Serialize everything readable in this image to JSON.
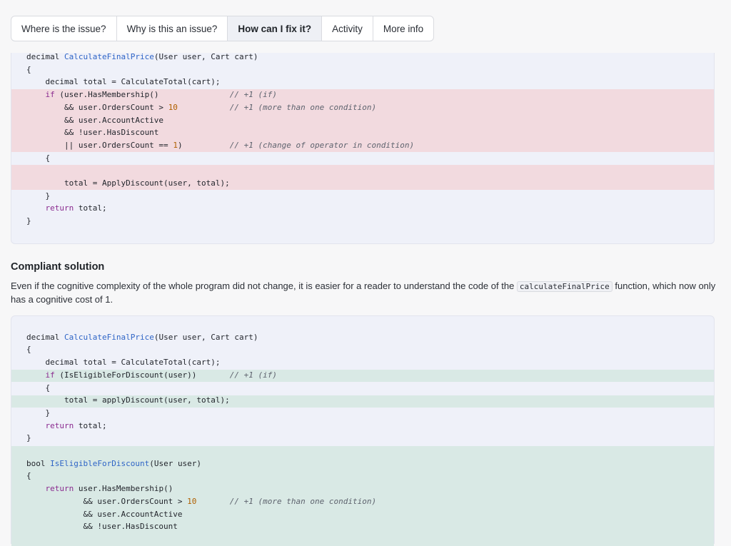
{
  "tabs": [
    {
      "label": "Where is the issue?"
    },
    {
      "label": "Why is this an issue?"
    },
    {
      "label": "How can I fix it?",
      "active": true
    },
    {
      "label": "Activity"
    },
    {
      "label": "More info"
    }
  ],
  "noncompliant_code": [
    "decimal CalculateFinalPrice(User user, Cart cart)",
    "{",
    "    decimal total = CalculateTotal(cart);",
    "    if (user.HasMembership()               // +1 (if)",
    "        && user.OrdersCount > 10           // +1 (more than one condition)",
    "        && user.AccountActive",
    "        && !user.HasDiscount",
    "        || user.OrdersCount == 1)          // +1 (change of operator in condition)",
    "    {",
    "",
    "        total = ApplyDiscount(user, total);",
    "    }",
    "    return total;",
    "}"
  ],
  "compliant": {
    "title": "Compliant solution",
    "text_before": "Even if the cognitive complexity of the whole program did not change, it is easier for a reader to understand the code of the ",
    "inline_code": "calculateFinalPrice",
    "text_after": " function, which now only has a cognitive cost of 1."
  },
  "compliant_code": [
    "",
    "decimal CalculateFinalPrice(User user, Cart cart)",
    "{",
    "    decimal total = CalculateTotal(cart);",
    "    if (IsEligibleForDiscount(user))       // +1 (if)",
    "    {",
    "        total = applyDiscount(user, total);",
    "    }",
    "    return total;",
    "}",
    "",
    "bool IsEligibleForDiscount(User user)",
    "{",
    "    return user.HasMembership()",
    "            && user.OrdersCount > 10       // +1 (more than one condition)",
    "            && user.AccountActive",
    "            && !user.HasDiscount"
  ],
  "colors": {
    "removed_highlight": "#f2dadf",
    "added_highlight": "#d9e9e5",
    "keyword": "#8a2a8f",
    "function_name": "#2f65c6",
    "number": "#b06000"
  }
}
